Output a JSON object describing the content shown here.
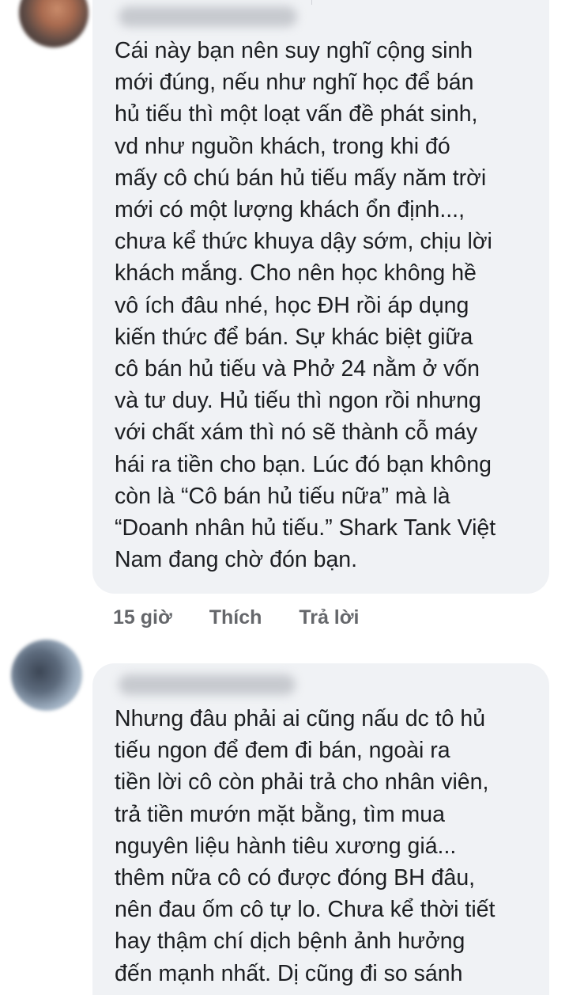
{
  "comments": [
    {
      "author": "Pham Thanh Long",
      "lines": [
        "Cái này bạn nên suy nghĩ cộng sinh",
        "mới đúng, nếu như nghĩ học để bán",
        "hủ tiếu thì một loạt vấn đề phát sinh,",
        "vd như nguồn khách, trong khi đó",
        "mấy cô chú bán hủ tiếu mấy năm trời",
        "mới có một lượng khách ổn định...,",
        "chưa kể thức khuya dậy sớm, chịu lời",
        "khách mắng. Cho nên học không hề",
        "vô ích đâu nhé, học ĐH rồi áp dụng",
        "kiến thức để bán. Sự khác biệt giữa",
        "cô bán hủ tiếu và Phở 24 nằm ở vốn",
        "và tư duy. Hủ tiếu thì ngon rồi nhưng",
        "với chất xám thì nó sẽ thành cỗ máy",
        "hái ra tiền cho bạn. Lúc đó bạn không",
        "còn là “Cô bán hủ tiếu nữa” mà là",
        "“Doanh nhân hủ tiếu.” Shark Tank Việt",
        "Nam đang chờ đón bạn."
      ],
      "time": "15 giờ",
      "like_label": "Thích",
      "reply_label": "Trả lời"
    },
    {
      "author": "Thanh Thao Pham",
      "lines": [
        "Nhưng đâu phải ai cũng nấu dc tô hủ",
        "tiếu ngon để đem đi bán, ngoài ra",
        "tiền lời cô còn phải trả cho nhân viên,",
        "trả tiền mướn mặt bằng, tìm mua",
        "nguyên liệu hành tiêu xương giá...",
        "thêm nữa cô có được đóng BH đâu,",
        "nên đau ốm cô tự lo. Chưa kể thời tiết",
        "hay thậm chí dịch bệnh ảnh hưởng",
        "đến mạnh nhất. Dị cũng đi so sánh"
      ]
    }
  ],
  "colors": {
    "bubble": "#f0f2f5",
    "text": "#1c1e21",
    "secondary": "#65676b"
  }
}
